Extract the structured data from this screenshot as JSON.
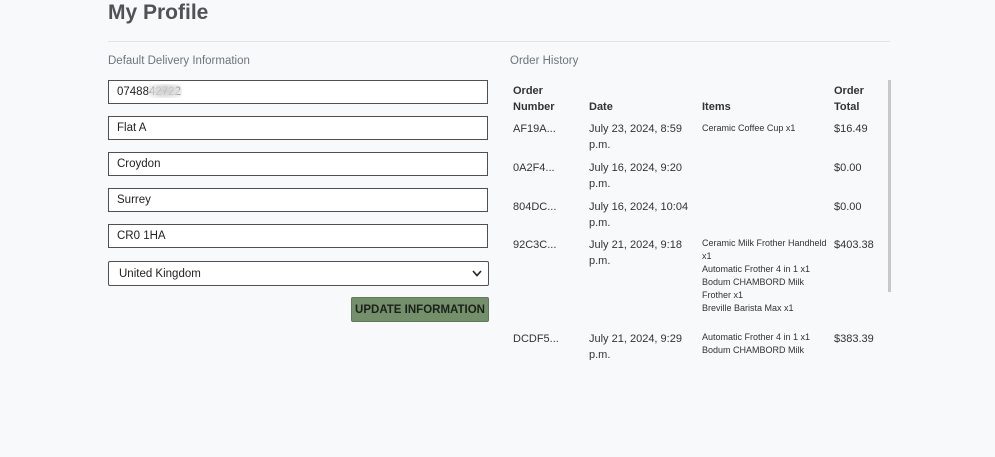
{
  "page": {
    "title": "My Profile"
  },
  "delivery": {
    "heading": "Default Delivery Information",
    "phone": "0748842722",
    "address_line": "Flat A",
    "city": "Croydon",
    "county": "Surrey",
    "postcode": "CR0 1HA",
    "country": "United Kingdom",
    "update_label": "UPDATE INFORMATION"
  },
  "orders": {
    "heading": "Order History",
    "columns": {
      "number_line1": "Order",
      "number_line2": "Number",
      "date": "Date",
      "items": "Items",
      "total_line1": "Order",
      "total_line2": "Total"
    },
    "rows": [
      {
        "number": "AF19A...",
        "date_line1": "July 23, 2024, 8:59",
        "date_line2": "p.m.",
        "items": [
          "Ceramic Coffee Cup x1"
        ],
        "total": "$16.49"
      },
      {
        "number": "0A2F4...",
        "date_line1": "July 16, 2024, 9:20",
        "date_line2": "p.m.",
        "items": [],
        "total": "$0.00"
      },
      {
        "number": "804DC...",
        "date_line1": "July 16, 2024, 10:04",
        "date_line2": "p.m.",
        "items": [],
        "total": "$0.00"
      },
      {
        "number": "92C3C...",
        "date_line1": "July 21, 2024, 9:18",
        "date_line2": "p.m.",
        "items": [
          "Ceramic Milk Frother Handheld",
          "x1",
          "Automatic Frother 4 in 1 x1",
          "Bodum CHAMBORD Milk",
          "Frother x1",
          "Breville Barista Max x1"
        ],
        "total": "$403.38"
      },
      {
        "number": "DCDF5...",
        "date_line1": "July 21, 2024, 9:29",
        "date_line2": "p.m.",
        "items": [
          "Automatic Frother 4 in 1 x1",
          "Bodum CHAMBORD Milk"
        ],
        "total": "$383.39"
      }
    ]
  },
  "colors": {
    "button": "#74906a",
    "title": "#505256",
    "muted": "#6c757d"
  }
}
